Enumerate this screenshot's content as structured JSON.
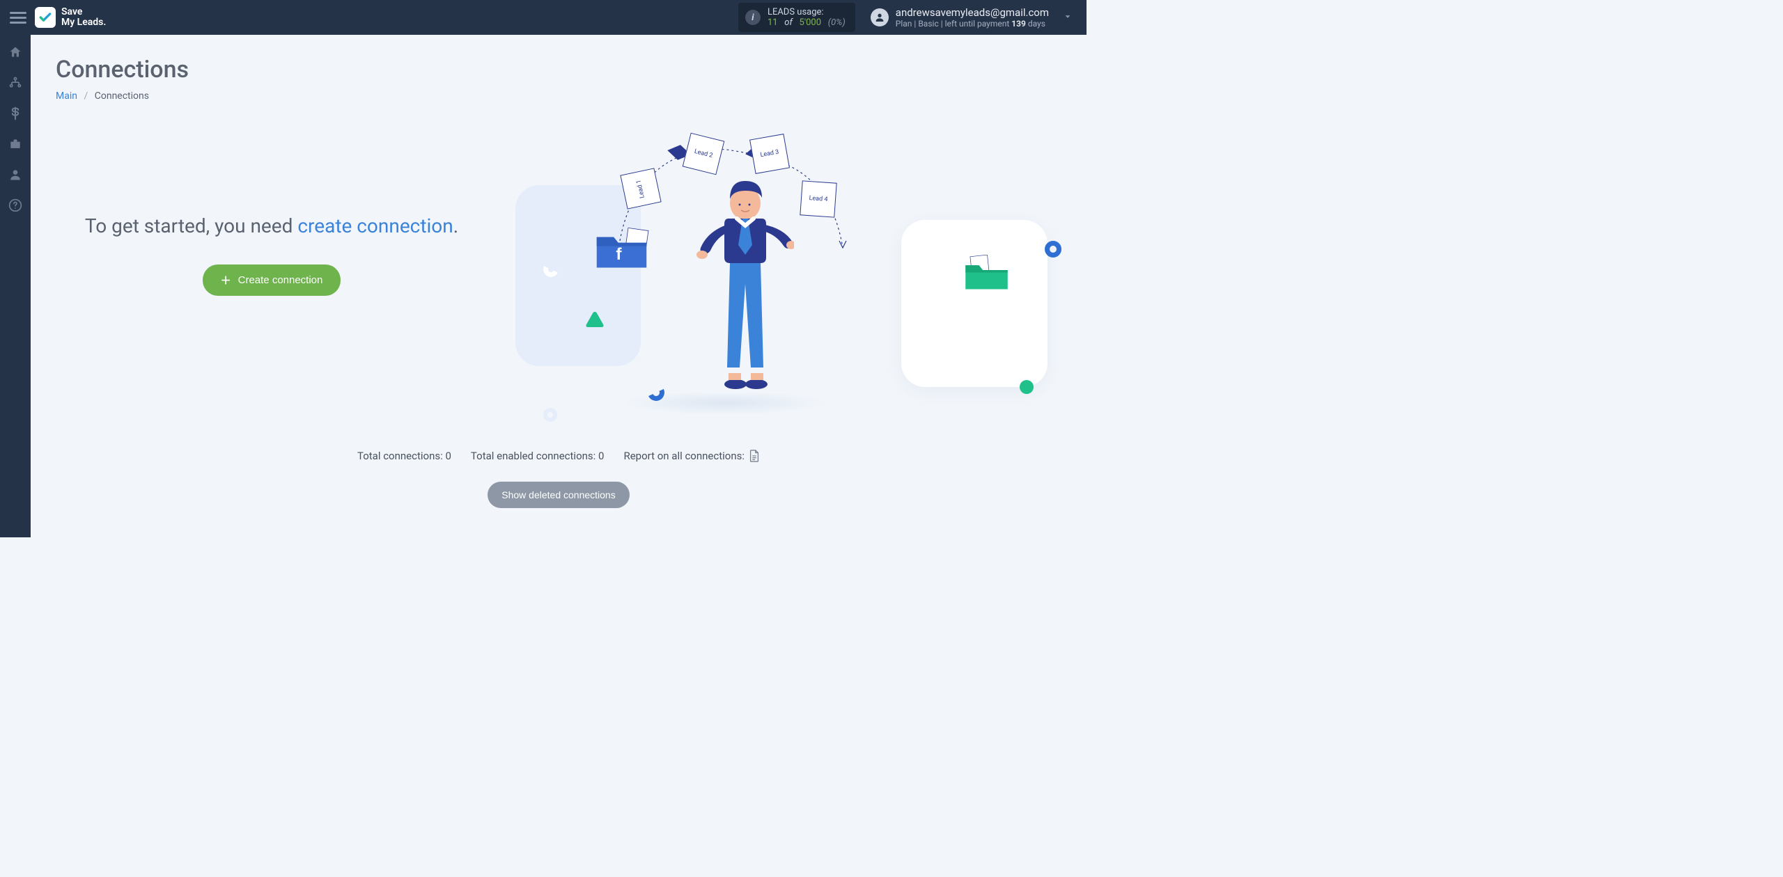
{
  "brand": {
    "line1": "Save",
    "line2": "My Leads."
  },
  "header": {
    "usage": {
      "label": "LEADS usage:",
      "current": "11",
      "of_word": "of",
      "limit": "5'000",
      "percentage": "(0%)"
    },
    "account": {
      "email": "andrewsavemyleads@gmail.com",
      "plan_prefix": "Plan |",
      "plan_name": "Basic",
      "plan_mid": "| left until payment",
      "days_count": "139",
      "days_word": "days"
    }
  },
  "sidebar": {
    "items": [
      {
        "name": "home"
      },
      {
        "name": "connections"
      },
      {
        "name": "billing"
      },
      {
        "name": "briefcase"
      },
      {
        "name": "account"
      },
      {
        "name": "help"
      }
    ]
  },
  "page": {
    "title": "Connections",
    "breadcrumb": {
      "main": "Main",
      "current": "Connections"
    },
    "hero_text_prefix": "To get started, you need ",
    "hero_text_link": "create connection",
    "hero_text_suffix": ".",
    "create_button": "Create connection",
    "illustration_labels": {
      "lead1": "Lead 1",
      "lead2": "Lead 2",
      "lead3": "Lead 3",
      "lead4": "Lead 4"
    },
    "stats": {
      "total_label": "Total connections:",
      "total_value": "0",
      "enabled_label": "Total enabled connections:",
      "enabled_value": "0",
      "report_label": "Report on all connections:"
    },
    "deleted_button": "Show deleted connections"
  },
  "colors": {
    "accent_green": "#6fb34d",
    "accent_blue": "#3b82d9",
    "topbar": "#253349"
  }
}
